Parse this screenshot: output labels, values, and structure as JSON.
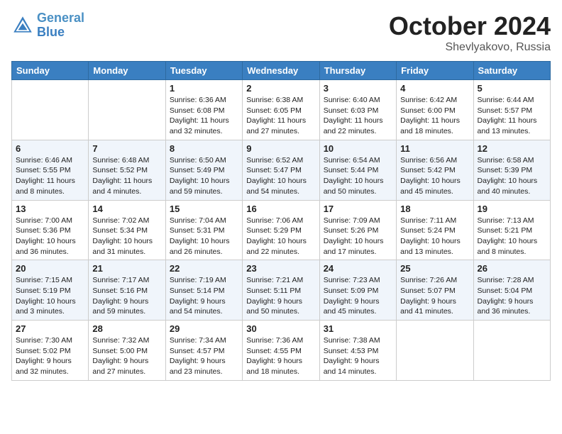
{
  "header": {
    "logo_line1": "General",
    "logo_line2": "Blue",
    "month": "October 2024",
    "location": "Shevlyakovo, Russia"
  },
  "weekdays": [
    "Sunday",
    "Monday",
    "Tuesday",
    "Wednesday",
    "Thursday",
    "Friday",
    "Saturday"
  ],
  "weeks": [
    [
      {
        "day": "",
        "info": ""
      },
      {
        "day": "",
        "info": ""
      },
      {
        "day": "1",
        "info": "Sunrise: 6:36 AM\nSunset: 6:08 PM\nDaylight: 11 hours and 32 minutes."
      },
      {
        "day": "2",
        "info": "Sunrise: 6:38 AM\nSunset: 6:05 PM\nDaylight: 11 hours and 27 minutes."
      },
      {
        "day": "3",
        "info": "Sunrise: 6:40 AM\nSunset: 6:03 PM\nDaylight: 11 hours and 22 minutes."
      },
      {
        "day": "4",
        "info": "Sunrise: 6:42 AM\nSunset: 6:00 PM\nDaylight: 11 hours and 18 minutes."
      },
      {
        "day": "5",
        "info": "Sunrise: 6:44 AM\nSunset: 5:57 PM\nDaylight: 11 hours and 13 minutes."
      }
    ],
    [
      {
        "day": "6",
        "info": "Sunrise: 6:46 AM\nSunset: 5:55 PM\nDaylight: 11 hours and 8 minutes."
      },
      {
        "day": "7",
        "info": "Sunrise: 6:48 AM\nSunset: 5:52 PM\nDaylight: 11 hours and 4 minutes."
      },
      {
        "day": "8",
        "info": "Sunrise: 6:50 AM\nSunset: 5:49 PM\nDaylight: 10 hours and 59 minutes."
      },
      {
        "day": "9",
        "info": "Sunrise: 6:52 AM\nSunset: 5:47 PM\nDaylight: 10 hours and 54 minutes."
      },
      {
        "day": "10",
        "info": "Sunrise: 6:54 AM\nSunset: 5:44 PM\nDaylight: 10 hours and 50 minutes."
      },
      {
        "day": "11",
        "info": "Sunrise: 6:56 AM\nSunset: 5:42 PM\nDaylight: 10 hours and 45 minutes."
      },
      {
        "day": "12",
        "info": "Sunrise: 6:58 AM\nSunset: 5:39 PM\nDaylight: 10 hours and 40 minutes."
      }
    ],
    [
      {
        "day": "13",
        "info": "Sunrise: 7:00 AM\nSunset: 5:36 PM\nDaylight: 10 hours and 36 minutes."
      },
      {
        "day": "14",
        "info": "Sunrise: 7:02 AM\nSunset: 5:34 PM\nDaylight: 10 hours and 31 minutes."
      },
      {
        "day": "15",
        "info": "Sunrise: 7:04 AM\nSunset: 5:31 PM\nDaylight: 10 hours and 26 minutes."
      },
      {
        "day": "16",
        "info": "Sunrise: 7:06 AM\nSunset: 5:29 PM\nDaylight: 10 hours and 22 minutes."
      },
      {
        "day": "17",
        "info": "Sunrise: 7:09 AM\nSunset: 5:26 PM\nDaylight: 10 hours and 17 minutes."
      },
      {
        "day": "18",
        "info": "Sunrise: 7:11 AM\nSunset: 5:24 PM\nDaylight: 10 hours and 13 minutes."
      },
      {
        "day": "19",
        "info": "Sunrise: 7:13 AM\nSunset: 5:21 PM\nDaylight: 10 hours and 8 minutes."
      }
    ],
    [
      {
        "day": "20",
        "info": "Sunrise: 7:15 AM\nSunset: 5:19 PM\nDaylight: 10 hours and 3 minutes."
      },
      {
        "day": "21",
        "info": "Sunrise: 7:17 AM\nSunset: 5:16 PM\nDaylight: 9 hours and 59 minutes."
      },
      {
        "day": "22",
        "info": "Sunrise: 7:19 AM\nSunset: 5:14 PM\nDaylight: 9 hours and 54 minutes."
      },
      {
        "day": "23",
        "info": "Sunrise: 7:21 AM\nSunset: 5:11 PM\nDaylight: 9 hours and 50 minutes."
      },
      {
        "day": "24",
        "info": "Sunrise: 7:23 AM\nSunset: 5:09 PM\nDaylight: 9 hours and 45 minutes."
      },
      {
        "day": "25",
        "info": "Sunrise: 7:26 AM\nSunset: 5:07 PM\nDaylight: 9 hours and 41 minutes."
      },
      {
        "day": "26",
        "info": "Sunrise: 7:28 AM\nSunset: 5:04 PM\nDaylight: 9 hours and 36 minutes."
      }
    ],
    [
      {
        "day": "27",
        "info": "Sunrise: 7:30 AM\nSunset: 5:02 PM\nDaylight: 9 hours and 32 minutes."
      },
      {
        "day": "28",
        "info": "Sunrise: 7:32 AM\nSunset: 5:00 PM\nDaylight: 9 hours and 27 minutes."
      },
      {
        "day": "29",
        "info": "Sunrise: 7:34 AM\nSunset: 4:57 PM\nDaylight: 9 hours and 23 minutes."
      },
      {
        "day": "30",
        "info": "Sunrise: 7:36 AM\nSunset: 4:55 PM\nDaylight: 9 hours and 18 minutes."
      },
      {
        "day": "31",
        "info": "Sunrise: 7:38 AM\nSunset: 4:53 PM\nDaylight: 9 hours and 14 minutes."
      },
      {
        "day": "",
        "info": ""
      },
      {
        "day": "",
        "info": ""
      }
    ]
  ]
}
